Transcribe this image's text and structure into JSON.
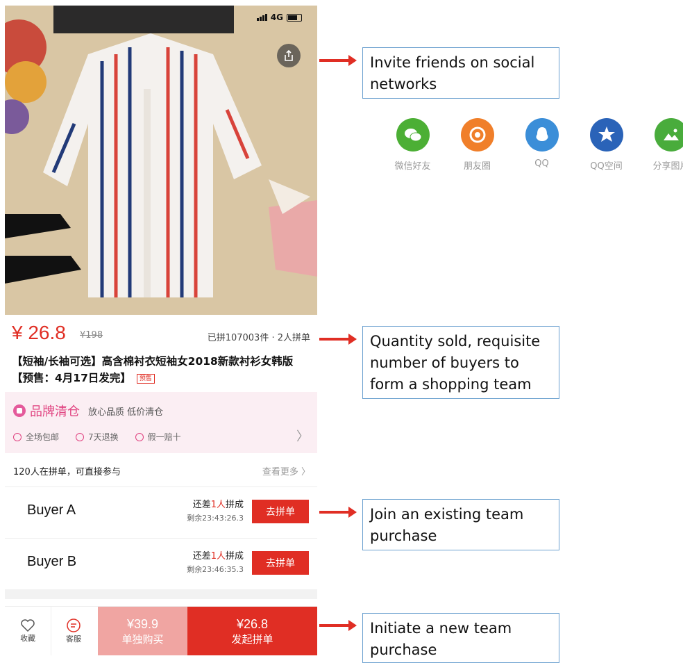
{
  "status_bar": {
    "network": "4G"
  },
  "product": {
    "price": "¥ 26.8",
    "original_price": "¥198",
    "sold_info": "已拼107003件 · 2人拼单",
    "title": "【短袖/长袖可选】高含棉衬衣短袖女2018新款衬衫女韩版【预售：4月17日发完】",
    "presale_tag": "预售"
  },
  "brand": {
    "name": "品牌清仓",
    "slogan": "放心品质 低价清仓",
    "features": [
      "全场包邮",
      "7天退换",
      "假一赔十"
    ]
  },
  "group": {
    "header": "120人在拼单，可直接参与",
    "more": "查看更多 〉",
    "buyers": [
      {
        "name": "Buyer A",
        "need_prefix": "还差",
        "need_count": "1人",
        "need_suffix": "拼成",
        "remaining": "剩余23:43:26.3",
        "button": "去拼单"
      },
      {
        "name": "Buyer B",
        "need_prefix": "还差",
        "need_count": "1人",
        "need_suffix": "拼成",
        "remaining": "剩余23:46:35.3",
        "button": "去拼单"
      }
    ]
  },
  "bottom_bar": {
    "favorite": "收藏",
    "service": "客服",
    "solo_price": "¥39.9",
    "solo_label": "单独购买",
    "team_price": "¥26.8",
    "team_label": "发起拼单"
  },
  "share_targets": [
    {
      "label": "微信好友",
      "color": "#4caf35",
      "icon": "wechat-icon"
    },
    {
      "label": "朋友圈",
      "color": "#f07f2a",
      "icon": "moments-icon"
    },
    {
      "label": "QQ",
      "color": "#3b8ed8",
      "icon": "qq-icon"
    },
    {
      "label": "QQ空间",
      "color": "#2a63b8",
      "icon": "qzone-icon"
    },
    {
      "label": "分享图片",
      "color": "#49ac3c",
      "icon": "share-image-icon"
    }
  ],
  "annotations": [
    "Invite friends on social networks",
    "Quantity sold, requisite number of buyers to form a shopping team",
    "Join an existing team purchase",
    "Initiate a new team purchase"
  ],
  "colors": {
    "accent": "#e02e24",
    "brand_pink": "#e0417f",
    "callout_border": "#6aa0cf"
  }
}
